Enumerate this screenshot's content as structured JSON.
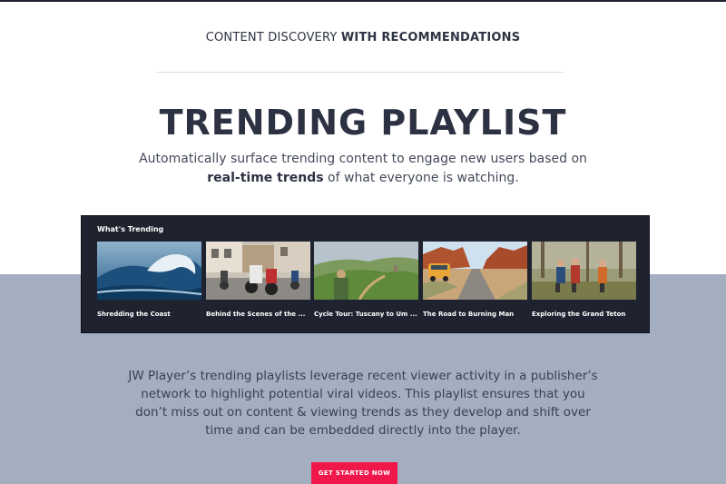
{
  "header": {
    "eyebrow_light": "CONTENT DISCOVERY",
    "eyebrow_bold": "WITH RECOMMENDATIONS"
  },
  "hero": {
    "title": "TRENDING PLAYLIST",
    "subtitle_line1": "Automatically surface trending content to engage new users based on",
    "subtitle_bold": "real-time trends",
    "subtitle_line2_rest": " of what everyone is watching."
  },
  "widget": {
    "title": "What's Trending",
    "items": [
      {
        "title": "Shredding the Coast",
        "thumb": "ocean-wave-surf"
      },
      {
        "title": "Behind the Scenes of the ...",
        "thumb": "motorcycle-street"
      },
      {
        "title": "Cycle Tour: Tuscany to Um ...",
        "thumb": "green-hills-cyclist"
      },
      {
        "title": "The Road to Burning Man",
        "thumb": "desert-road-van"
      },
      {
        "title": "Exploring the Grand Teton",
        "thumb": "hikers-forest"
      }
    ]
  },
  "body": {
    "line1": "JW Player’s trending playlists leverage recent viewer activity in a publisher’s",
    "line2": "network to highlight potential viral videos. This playlist ensures that you",
    "line3": "don’t miss out on content & viewing trends as they develop and shift over",
    "line4": "time and can be embedded directly into the player."
  },
  "cta": {
    "label": "GET STARTED NOW",
    "color": "#f0174b"
  },
  "colors": {
    "band": "#a4aec1",
    "widget_bg": "#1f2330",
    "text_dark": "#2d3243"
  }
}
